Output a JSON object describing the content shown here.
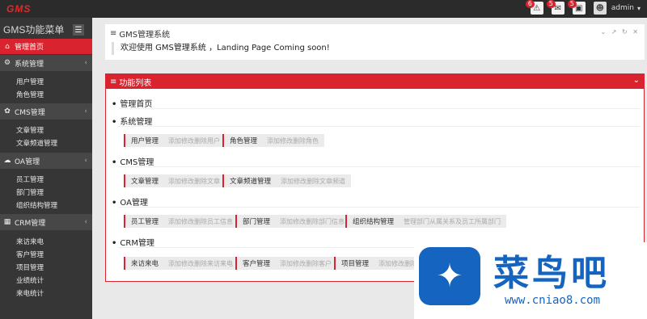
{
  "app": {
    "logo": "GMS"
  },
  "topbar": {
    "badges": [
      "6",
      "5",
      "5"
    ],
    "username": "admin"
  },
  "sidebar": {
    "title": "GMS功能菜单",
    "home": "管理首页",
    "sections": [
      {
        "label": "系统管理",
        "items": [
          "用户管理",
          "角色管理"
        ]
      },
      {
        "label": "CMS管理",
        "items": [
          "文章管理",
          "文章频道管理"
        ]
      },
      {
        "label": "OA管理",
        "items": [
          "员工管理",
          "部门管理",
          "组织结构管理"
        ]
      },
      {
        "label": "CRM管理",
        "items": [
          "来访来电",
          "客户管理",
          "项目管理",
          "业绩统计",
          "来电统计"
        ]
      }
    ]
  },
  "panel1": {
    "title": "GMS管理系统",
    "welcome": "欢迎使用 GMS管理系统 ，Landing Page Coming soon!"
  },
  "panel2": {
    "title": "功能列表",
    "groups": [
      {
        "label": "管理首页",
        "items": []
      },
      {
        "label": "系统管理",
        "items": [
          {
            "name": "用户管理",
            "desc": "添加修改删除用户"
          },
          {
            "name": "角色管理",
            "desc": "添加修改删除角色"
          }
        ]
      },
      {
        "label": "CMS管理",
        "items": [
          {
            "name": "文章管理",
            "desc": "添加修改删除文章"
          },
          {
            "name": "文章频道管理",
            "desc": "添加修改删除文章频道"
          }
        ]
      },
      {
        "label": "OA管理",
        "items": [
          {
            "name": "员工管理",
            "desc": "添加修改删除员工信息"
          },
          {
            "name": "部门管理",
            "desc": "添加修改删除部门信息"
          },
          {
            "name": "组织结构管理",
            "desc": "管理部门从属关系及员工所属部门"
          }
        ]
      },
      {
        "label": "CRM管理",
        "items": [
          {
            "name": "来访来电",
            "desc": "添加修改删除来访来电"
          },
          {
            "name": "客户管理",
            "desc": "添加修改删除客户"
          },
          {
            "name": "项目管理",
            "desc": "添加修改删除项目"
          }
        ]
      }
    ]
  },
  "watermark": {
    "brand": "菜鸟吧",
    "url": "www.cniao8.com"
  }
}
